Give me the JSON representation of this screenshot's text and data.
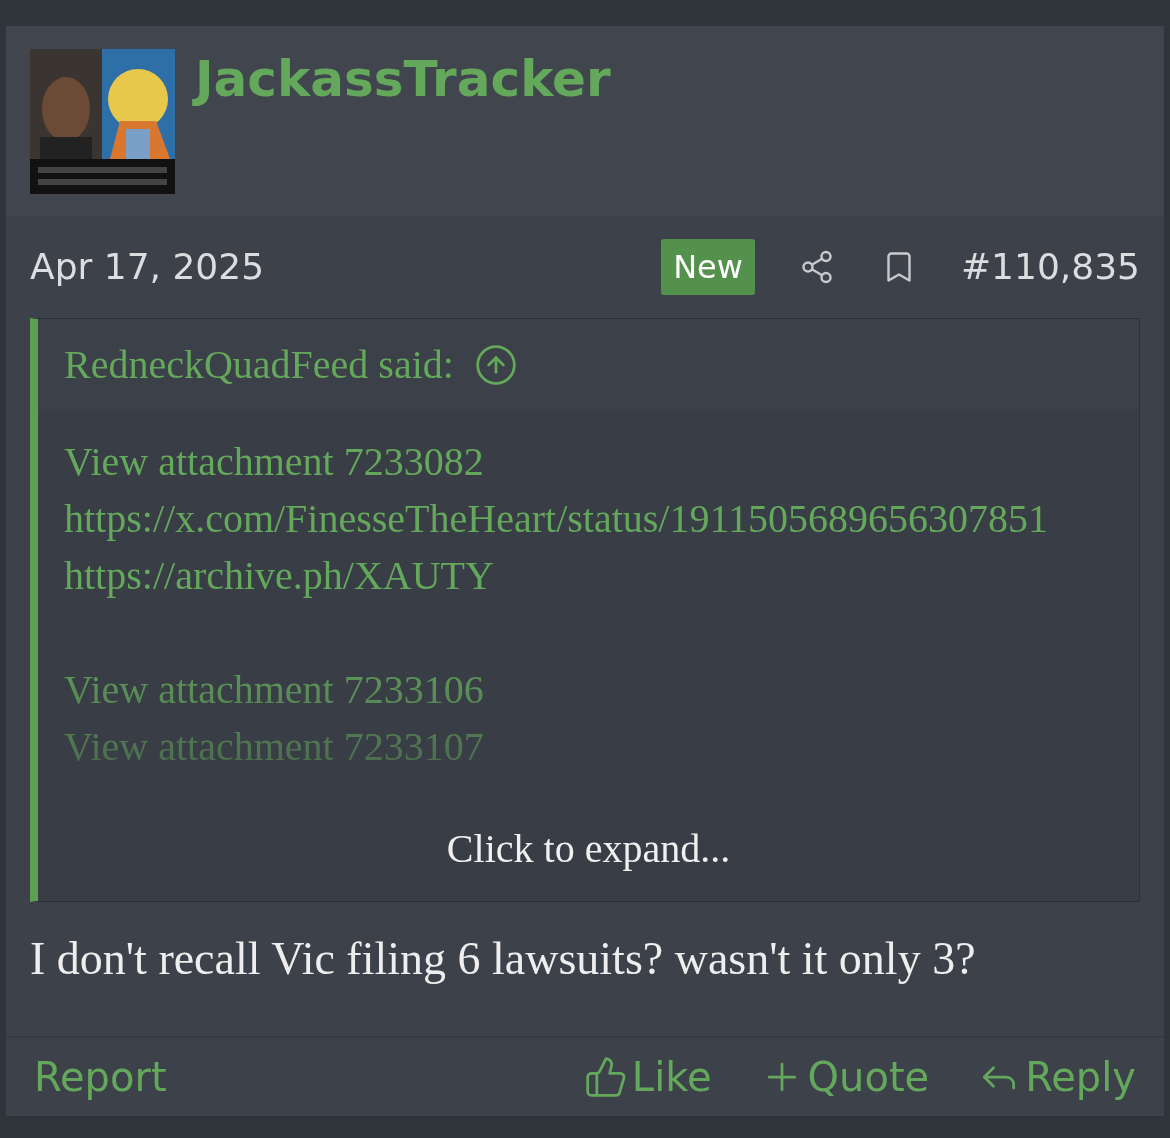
{
  "post": {
    "author": "JackassTracker",
    "date": "Apr 17, 2025",
    "new_badge": "New",
    "number": "#110,835",
    "quote": {
      "author": "RedneckQuadFeed said:",
      "collapsed": true,
      "paragraphs": [
        [
          "View attachment 7233082",
          "https://x.com/FinesseTheHeart/status/1911505689656307851",
          "https://archive.ph/XAUTY"
        ],
        [
          "View attachment 7233106",
          "View attachment 7233107"
        ]
      ],
      "expand_label": "Click to expand..."
    },
    "body": "I don't recall Vic filing 6 lawsuits? wasn't it only 3?",
    "footer": {
      "report": "Report",
      "actions": [
        {
          "kind": "like",
          "label": "Like"
        },
        {
          "kind": "quote",
          "label": "Quote"
        },
        {
          "kind": "reply",
          "label": "Reply"
        }
      ]
    }
  }
}
